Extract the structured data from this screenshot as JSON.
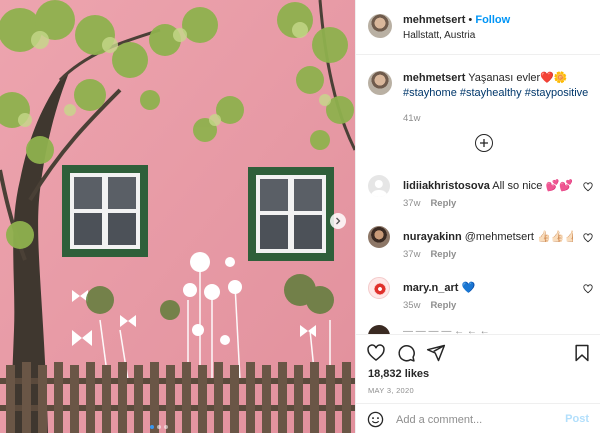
{
  "post": {
    "username": "mehmetsert",
    "follow_label": "Follow",
    "location": "Hallstatt, Austria",
    "caption_text": "Yaşanası evler",
    "caption_emoji": "❤️🌼",
    "hashtags": [
      "#stayhome",
      "#stayhealthy",
      "#staypositive"
    ],
    "age": "41w"
  },
  "comments": [
    {
      "username": "lidiiakhristosova",
      "text": "All so nice 💕💕💕",
      "age": "37w",
      "reply_label": "Reply"
    },
    {
      "username": "nurayakinn",
      "text": "@mehmetsert 👍🏻👍🏻👍🏻",
      "age": "37w",
      "reply_label": "Reply"
    },
    {
      "username": "mary.n_art",
      "text": "💙",
      "age": "35w",
      "reply_label": "Reply"
    }
  ],
  "partial_comment": "— — — — ← ← ←",
  "stats": {
    "likes": "18,832 likes",
    "date": "MAY 3, 2020"
  },
  "composer": {
    "placeholder": "Add a comment...",
    "post_label": "Post"
  },
  "carousel": {
    "slide_count": 3,
    "active_slide": 1
  },
  "colors": {
    "accent": "#0095f6",
    "hashtag": "#00376b",
    "muted": "#8e8e8e",
    "wall": "#e99aa5",
    "window_frame": "#2f5f3a"
  },
  "icons": [
    "heart-icon",
    "comment-icon",
    "share-icon",
    "bookmark-icon",
    "emoji-icon",
    "plus-circle-icon",
    "chevron-right-icon"
  ]
}
